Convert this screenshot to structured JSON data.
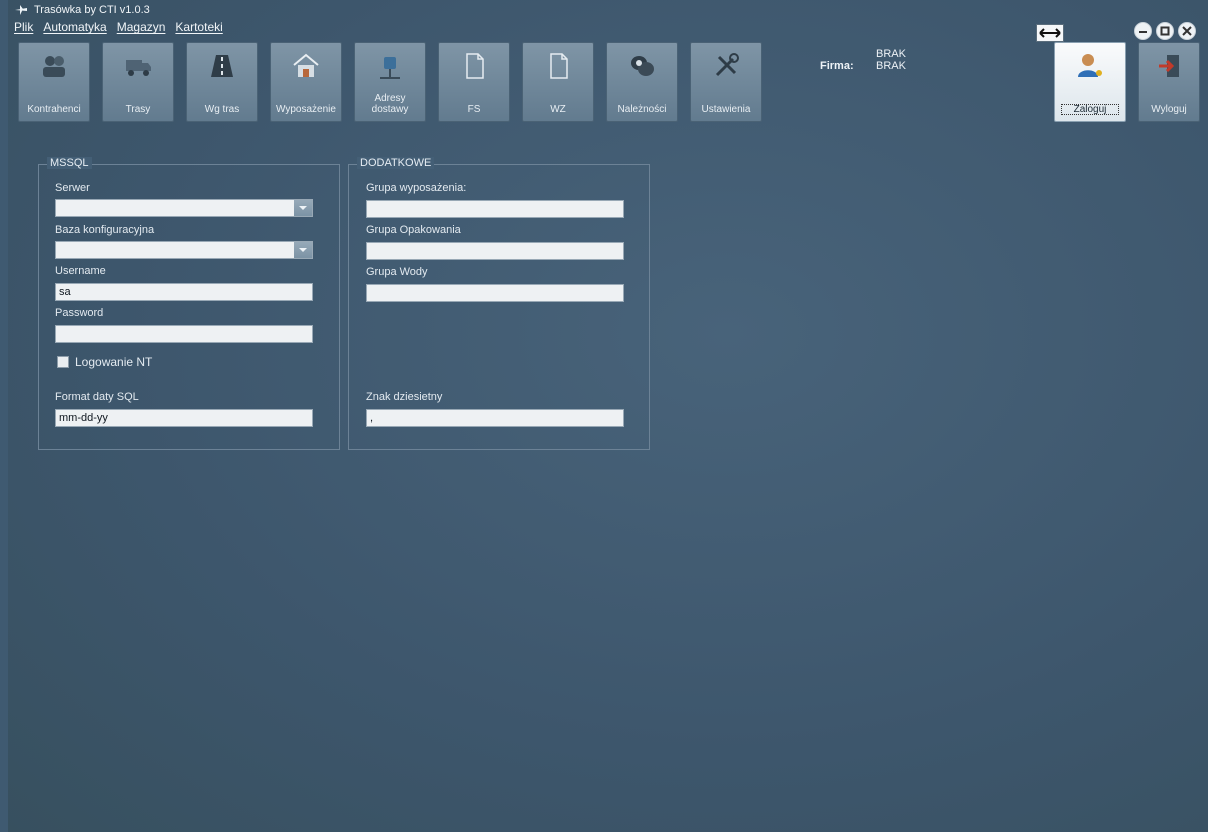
{
  "window": {
    "title": "Trasówka by CTI v1.0.3"
  },
  "menu": [
    "Plik",
    "Automatyka",
    "Magazyn",
    "Kartoteki"
  ],
  "toolbar": [
    {
      "label": "Kontrahenci",
      "icon": "contacts-icon"
    },
    {
      "label": "Trasy",
      "icon": "truck-icon"
    },
    {
      "label": "Wg tras",
      "icon": "road-icon"
    },
    {
      "label": "Wyposażenie",
      "icon": "house-icon"
    },
    {
      "label": "Adresy dostawy",
      "icon": "mailbox-icon"
    },
    {
      "label": "FS",
      "icon": "document-icon"
    },
    {
      "label": "WZ",
      "icon": "document-icon"
    },
    {
      "label": "Należności",
      "icon": "money-icon"
    },
    {
      "label": "Ustawienia",
      "icon": "tools-icon"
    },
    {
      "label": "Zaloguj",
      "icon": "user-key-icon",
      "active": true
    },
    {
      "label": "Wyloguj",
      "icon": "logout-icon"
    }
  ],
  "firma": {
    "label": "Firma:",
    "value1": "BRAK",
    "value2": "BRAK"
  },
  "mssql": {
    "title": "MSSQL",
    "serwer_label": "Serwer",
    "serwer_value": "",
    "baza_label": "Baza konfiguracyjna",
    "baza_value": "",
    "username_label": "Username",
    "username_value": "sa",
    "password_label": "Password",
    "password_value": "",
    "nt_label": "Logowanie NT",
    "format_label": "Format daty SQL",
    "format_value": "mm-dd-yy"
  },
  "dodatkowe": {
    "title": "DODATKOWE",
    "wyposazenie_label": "Grupa wyposażenia:",
    "wyposazenie_value": "",
    "opakowania_label": "Grupa Opakowania",
    "opakowania_value": "",
    "wody_label": "Grupa Wody",
    "wody_value": "",
    "znak_label": "Znak dziesietny",
    "znak_value": ","
  }
}
